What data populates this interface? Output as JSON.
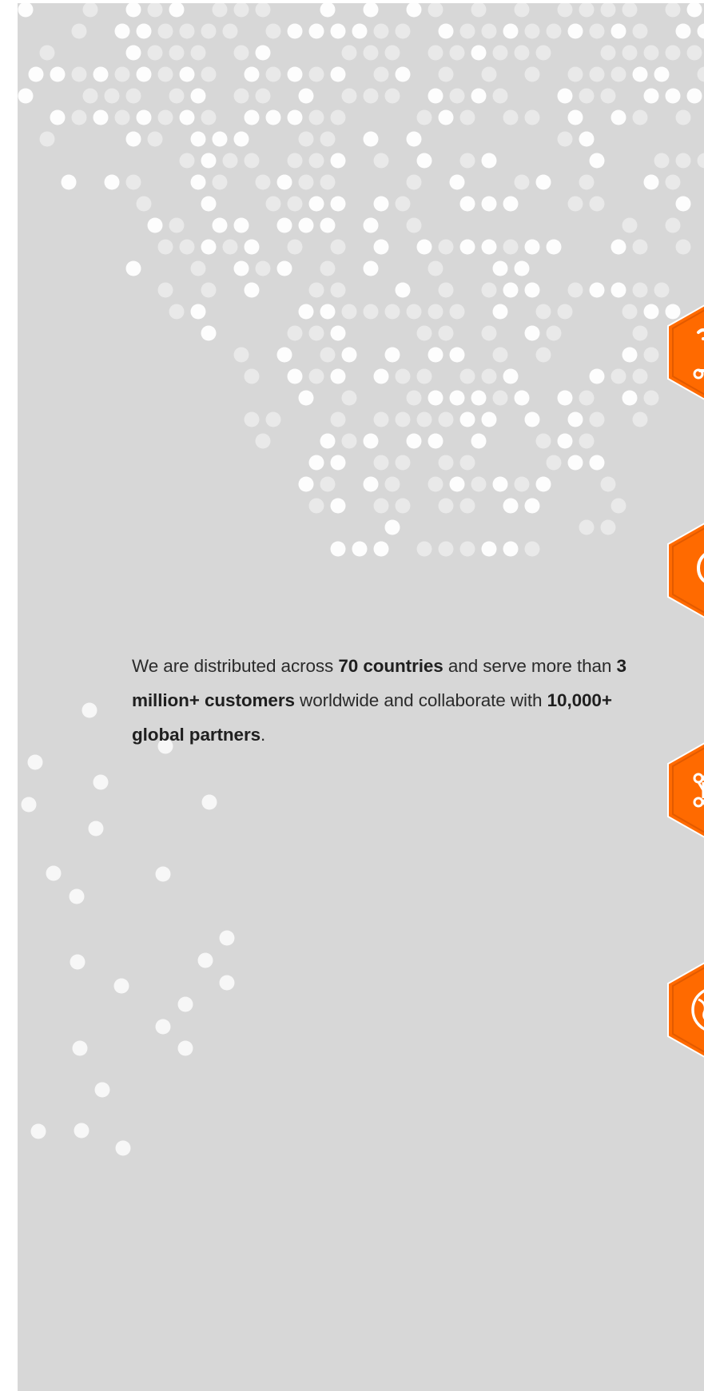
{
  "intro": {
    "p1": "We are distributed across ",
    "countries": "70 countries",
    "p2": " and serve more than ",
    "customers": "3 million+ customers",
    "p3": " worldwide and collaborate with ",
    "partners": "10,000+ global partners",
    "p4": "."
  },
  "icons": [
    {
      "name": "hand-coin-icon"
    },
    {
      "name": "lightbulb-icon"
    },
    {
      "name": "network-nodes-icon"
    },
    {
      "name": "globe-icon"
    }
  ],
  "colors": {
    "panel_bg": "#d7d7d7",
    "accent": "#ff6a00",
    "accent_dark": "#e25a00",
    "dot": "#ffffff",
    "text": "#2b2b2b"
  }
}
